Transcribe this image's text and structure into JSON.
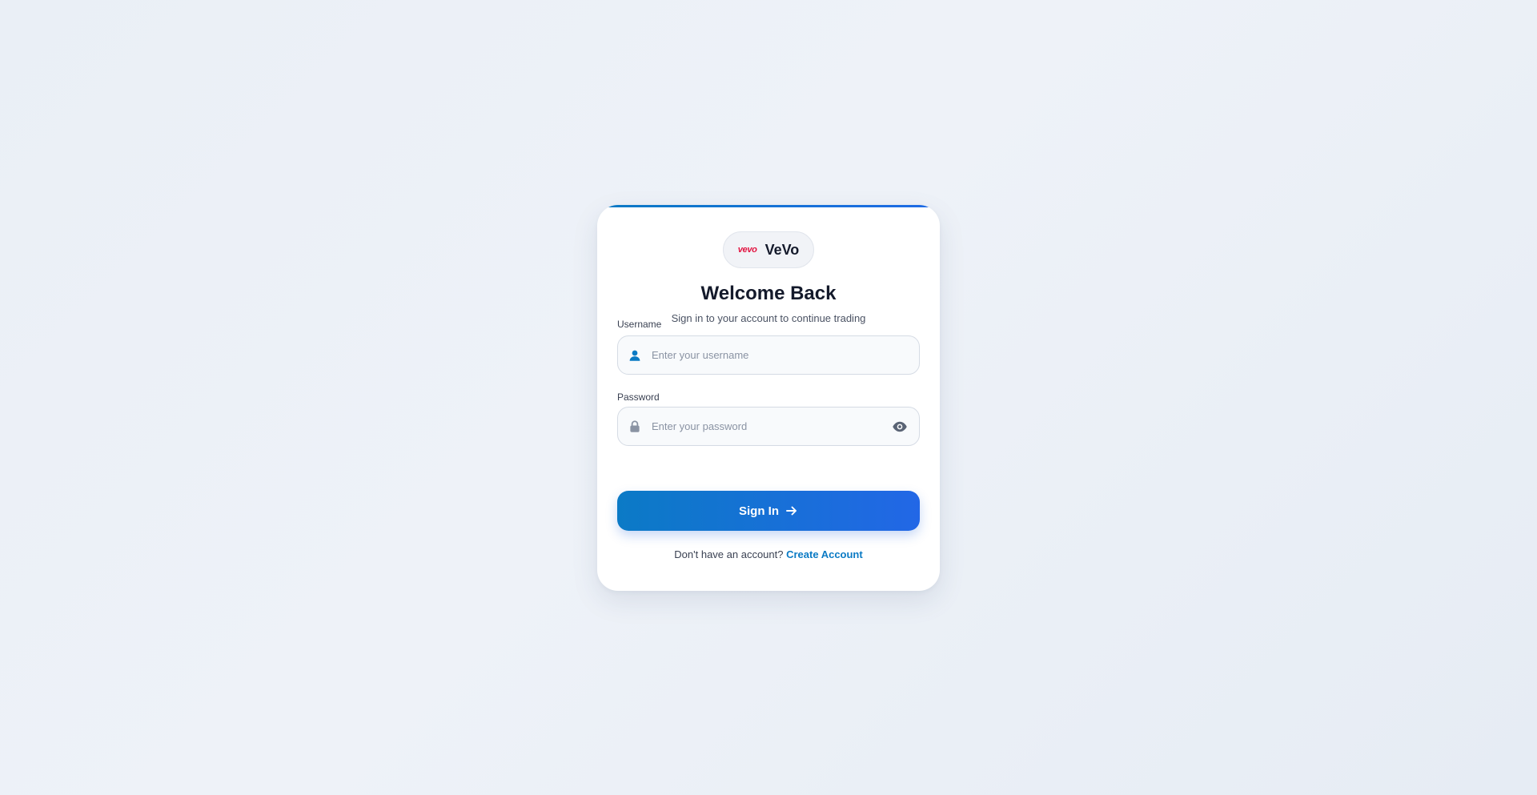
{
  "brand": {
    "logo_text": "vevo",
    "name": "VeVo"
  },
  "header": {
    "title": "Welcome Back",
    "subtitle": "Sign in to your account to continue trading"
  },
  "form": {
    "username": {
      "label": "Username",
      "placeholder": "Enter your username",
      "value": "",
      "icon": "user-icon"
    },
    "password": {
      "label": "Password",
      "placeholder": "Enter your password",
      "value": "",
      "icon": "lock-icon",
      "toggle_icon": "eye-icon"
    },
    "submit_label": "Sign In",
    "submit_icon": "arrow-right-icon"
  },
  "footer": {
    "prompt": "Don't have an account?",
    "link_label": "Create Account"
  },
  "colors": {
    "accent": "#0a7ac4",
    "button_start": "#0b7ac6",
    "button_end": "#2267e6",
    "brand_logo": "#e2123f",
    "title": "#141a2b"
  }
}
